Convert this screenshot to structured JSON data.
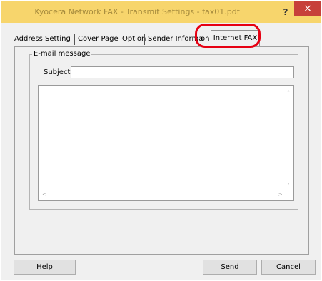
{
  "window": {
    "title": "Kyocera Network FAX - Transmit Settings - fax01.pdf",
    "help_label": "?",
    "close_label": "×"
  },
  "tabs": [
    {
      "label": "Address Setting"
    },
    {
      "label": "Cover Page"
    },
    {
      "label": "Option"
    },
    {
      "label": "Sender Informa"
    },
    {
      "label": "on"
    },
    {
      "label": "Internet FAX",
      "active": true
    }
  ],
  "email_message": {
    "group_title": "E-mail message",
    "subject_label": "Subject:",
    "subject_value": ""
  },
  "scroll": {
    "up": "˄",
    "down": "˅",
    "left": "<",
    "right": ">"
  },
  "buttons": {
    "help": "Help",
    "send": "Send",
    "cancel": "Cancel"
  },
  "colors": {
    "titlebar": "#f7d56c",
    "close": "#c7403a",
    "highlight": "#e60012"
  }
}
